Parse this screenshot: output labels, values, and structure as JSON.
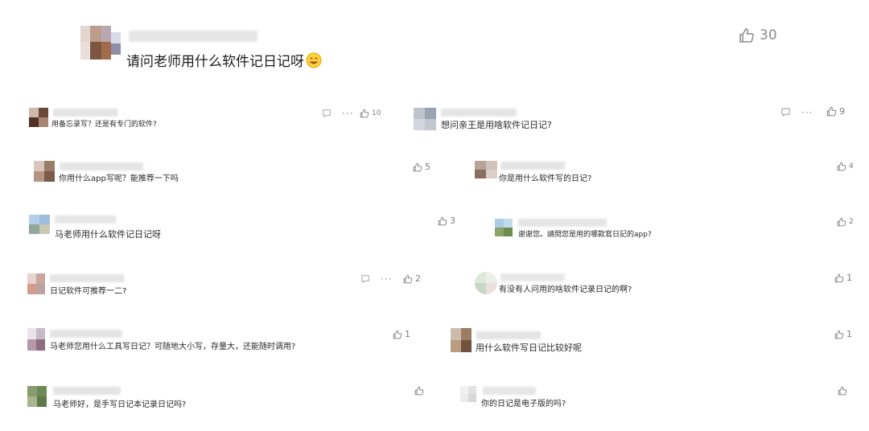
{
  "post": {
    "title": "请问老师用什么软件记日记呀",
    "like_count": "30"
  },
  "left_comments": [
    {
      "text": "用备忘录写？还是有专门的软件?",
      "likes": "10"
    },
    {
      "text": "你用什么app写呢？能推荐一下吗",
      "likes": "5"
    },
    {
      "text": "马老师用什么软件记日记呀",
      "likes": "3"
    },
    {
      "text": "日记软件可推荐一二?",
      "likes": "2"
    },
    {
      "text": "马老师您用什么工具写日记？可随地大小写，存量大，还能随时调用?",
      "likes": "1"
    },
    {
      "text": "马老师好，是手写日记本记录日记吗?",
      "likes": ""
    }
  ],
  "right_comments": [
    {
      "text": "想问亲王是用啥软件记日记?",
      "likes": "9"
    },
    {
      "text": "你是用什么软件写的日记?",
      "likes": "4"
    },
    {
      "text": "谢谢您。請問您是用的哪款寫日記的app?",
      "likes": "2"
    },
    {
      "text": "有没有人问用的啥软件记录日记的啊?",
      "likes": "1"
    },
    {
      "text": "用什么软件写日记比较好呢",
      "likes": "1"
    },
    {
      "text": "你的日记是电子版的吗?",
      "likes": ""
    }
  ],
  "colors": {
    "icon_gray": "#8a8a8a",
    "text": "#222222",
    "background": "#ffffff"
  }
}
